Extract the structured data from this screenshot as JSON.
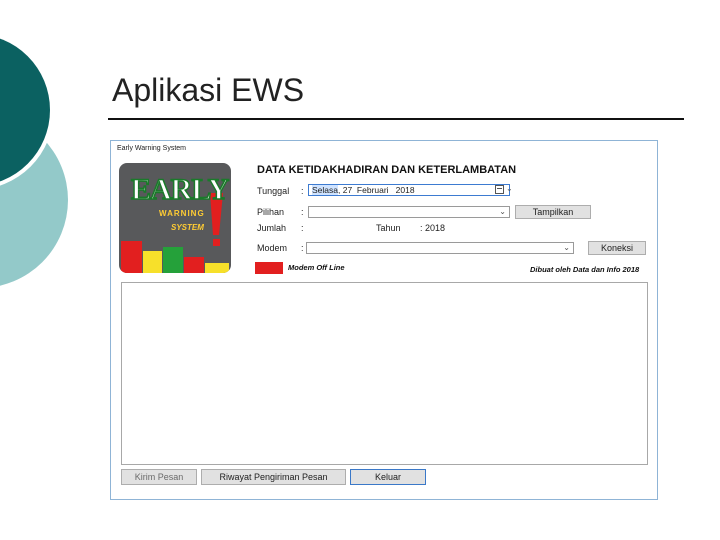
{
  "slide": {
    "title": "Aplikasi EWS"
  },
  "window": {
    "title": "Early Warning System"
  },
  "logo": {
    "big_text": "EARLY",
    "word2": "WARNING",
    "word3": "SYSTEM",
    "bar_colors": [
      "#e21f1f",
      "#f7e02a",
      "#25a13a",
      "#e21f1f",
      "#f7e02a"
    ]
  },
  "form": {
    "heading": "DATA KETIDAKHADIRAN DAN KETERLAMBATAN",
    "tanggal": {
      "label": "Tunggal",
      "colon": ":",
      "day": "Selasa",
      "date": ", 27",
      "month": "Februari",
      "year": "2018"
    },
    "pilihan": {
      "label": "Pilihan",
      "colon": ":",
      "value": ""
    },
    "jumlah": {
      "label": "Jumlah",
      "colon": ":",
      "tahun_label": "Tahun",
      "tahun_value": ": 2018"
    },
    "modem": {
      "label": "Modem",
      "colon": ":",
      "value": ""
    },
    "buttons": {
      "tampilkan": "Tampilkan",
      "koneksi": "Koneksi"
    }
  },
  "status": {
    "text": "Modem Off Line",
    "color": "#e21f1f",
    "credit": "Dibuat oleh Data dan Info 2018"
  },
  "footer_buttons": {
    "kirim": "Kirim Pesan",
    "riwayat": "Riwayat Pengiriman Pesan",
    "keluar": "Keluar"
  },
  "colors": {
    "deco_dark": "#0b6161",
    "deco_light": "#93c9c9",
    "window_border": "#8fb4d6"
  }
}
